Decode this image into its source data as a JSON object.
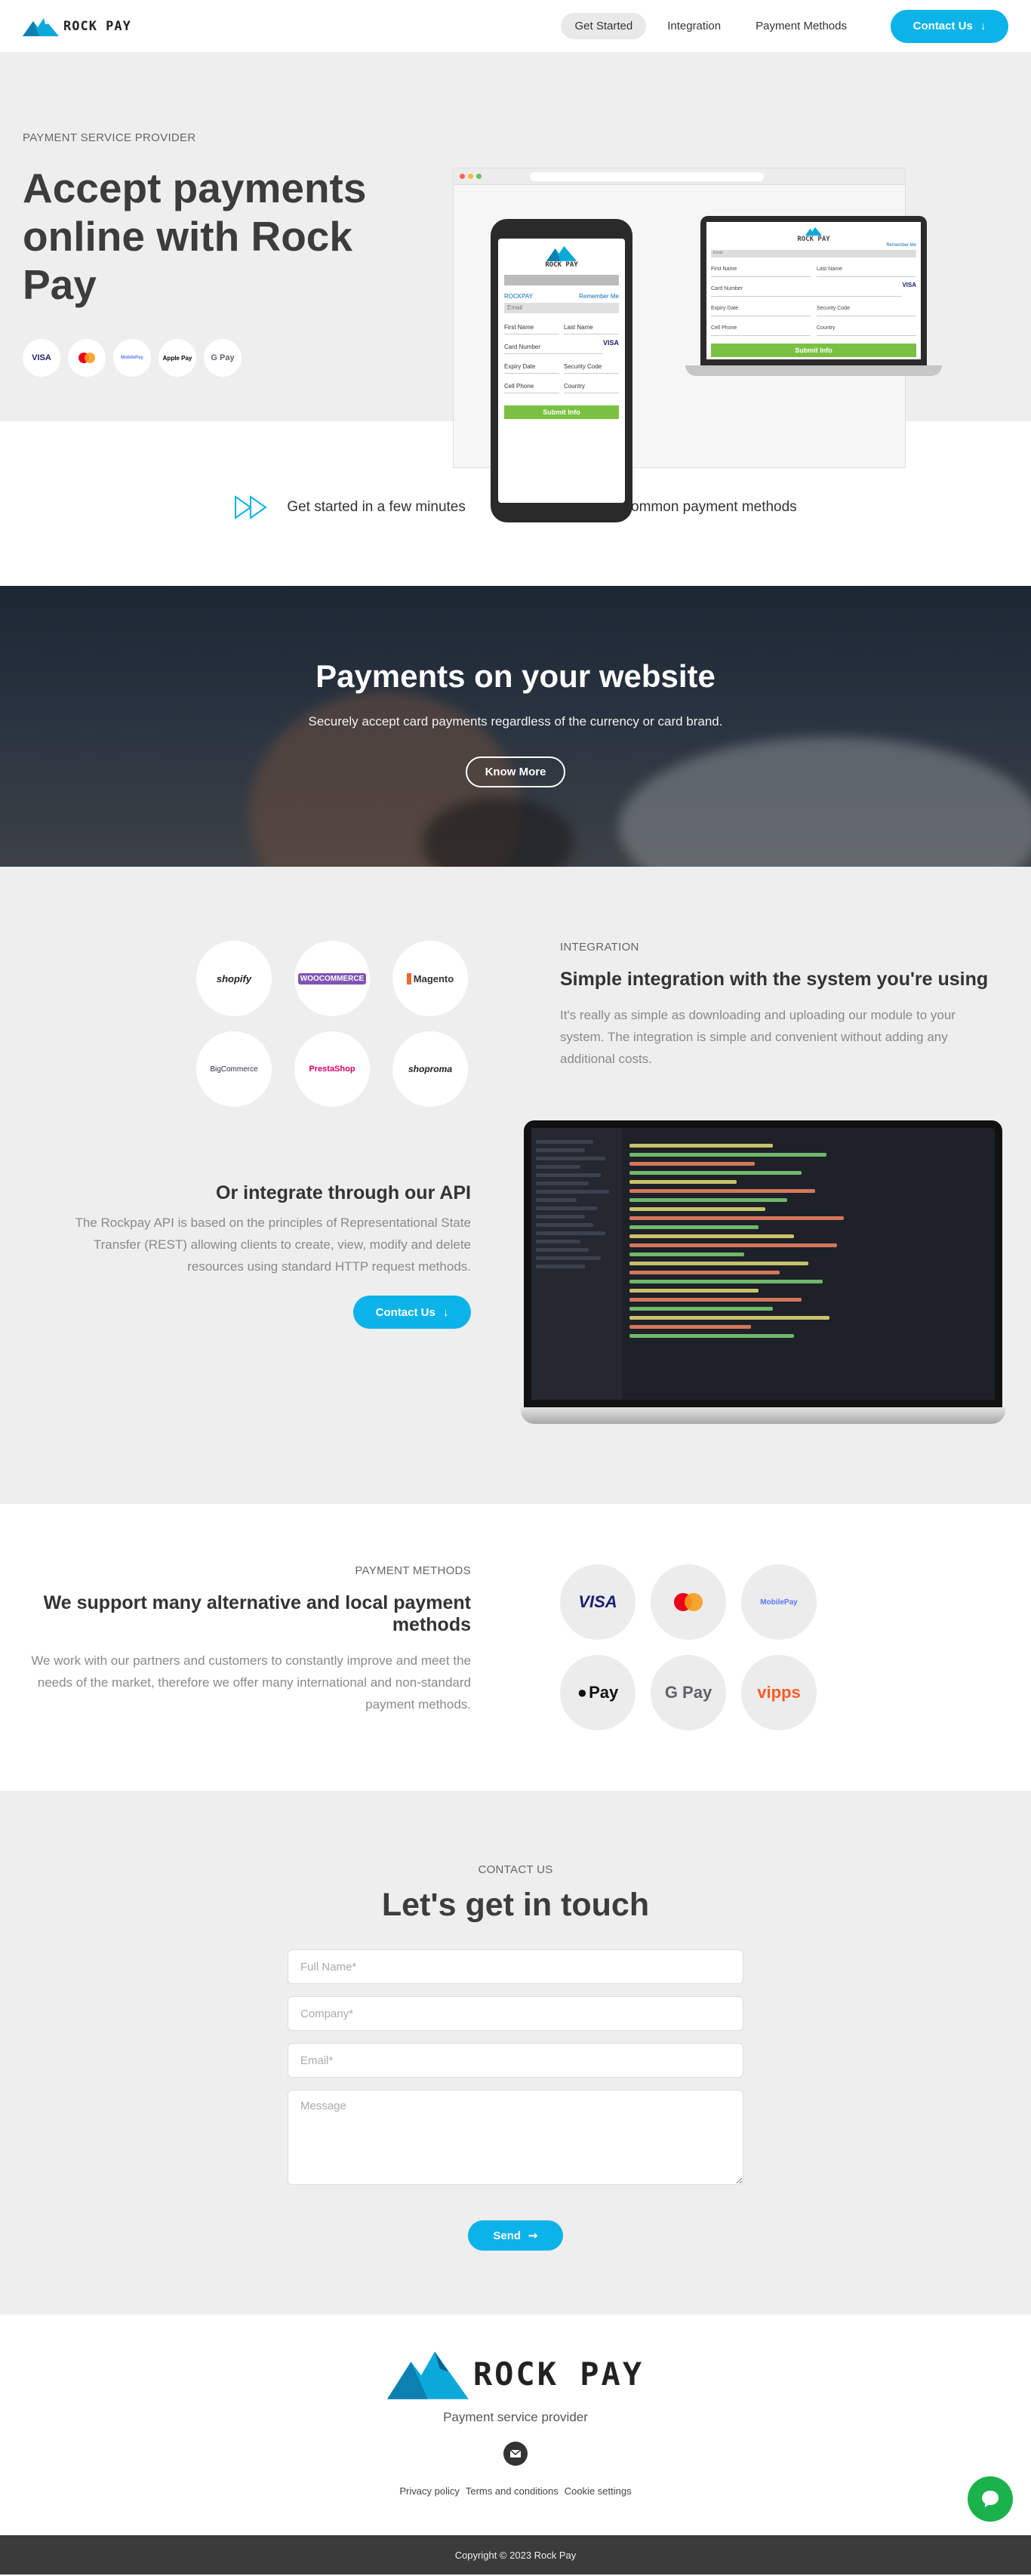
{
  "header": {
    "logo_text": "ROCK PAY",
    "nav": [
      "Get Started",
      "Integration",
      "Payment Methods"
    ],
    "contact_label": "Contact Us"
  },
  "hero": {
    "eyebrow": "PAYMENT SERVICE PROVIDER",
    "title": "Accept payments online with Rock Pay",
    "payment_icons": [
      "VISA",
      "mastercard",
      "MobilePay",
      "Apple Pay",
      "G Pay"
    ],
    "mockup": {
      "brand": "ROCK PAY",
      "rockpay_label": "ROCKPAY",
      "remember_label": "Remember Me",
      "email_label": "Email",
      "first_name": "First Name",
      "last_name": "Last Name",
      "card_number": "Card Number",
      "expiry_date": "Expiry Date",
      "security_code": "Security Code",
      "cell_phone": "Cell Phone",
      "country": "Country",
      "submit": "Submit Info",
      "card_logos": "VISA"
    }
  },
  "features": [
    {
      "icon": "fast-forward-icon",
      "text": "Get started in a few minutes"
    },
    {
      "icon": "card-payment-icon",
      "text": "Accept all common payment methods"
    }
  ],
  "website_banner": {
    "title": "Payments on your website",
    "subtitle": "Securely accept card payments regardless of the currency or card brand.",
    "button": "Know More"
  },
  "integration": {
    "platforms": [
      "shopify",
      "WOOCOMMERCE",
      "Magento",
      "BigCommerce",
      "PrestaShop",
      "shoproma"
    ],
    "eyebrow": "INTEGRATION",
    "title": "Simple integration with the system you're using",
    "body": "It's really as simple as downloading and uploading our module to your system. The integration is simple and convenient without adding any additional costs.",
    "api_title": "Or integrate through our API",
    "api_body": "The Rockpay API is based on the principles of Representational State Transfer (REST) allowing clients to create, view, modify and delete resources using standard HTTP request methods.",
    "api_button": "Contact Us"
  },
  "payment_methods": {
    "eyebrow": "PAYMENT METHODS",
    "title": "We support many alternative and local payment methods",
    "body": "We work with our partners and customers to constantly improve and meet the needs of the market, therefore we offer many international and non-standard payment methods.",
    "methods": [
      "VISA",
      "mastercard",
      "MobilePay",
      "Pay",
      "G Pay",
      "vipps"
    ]
  },
  "contact": {
    "eyebrow": "CONTACT US",
    "title": "Let's get in touch",
    "fields": {
      "full_name": "Full Name*",
      "company": "Company*",
      "email": "Email*",
      "message": "Message"
    },
    "send": "Send"
  },
  "footer": {
    "logo_text": "ROCK PAY",
    "tagline": "Payment service provider",
    "links": [
      "Privacy policy",
      "Terms and conditions",
      "Cookie settings"
    ],
    "copyright": "Copyright © 2023 Rock Pay"
  },
  "colors": {
    "accent": "#0bb3e8",
    "green": "#1bb24b",
    "dark": "#3c3c3c"
  }
}
